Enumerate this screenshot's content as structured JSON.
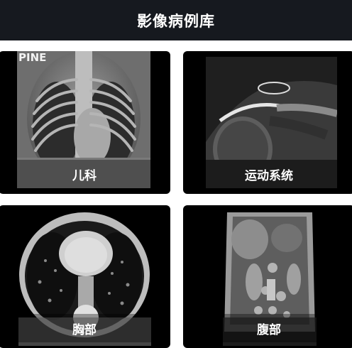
{
  "header": {
    "title": "影像病例库"
  },
  "cards": [
    {
      "label": "儿科",
      "image_text": "PINE"
    },
    {
      "label": "运动系统"
    },
    {
      "label": "胸部"
    },
    {
      "label": "腹部"
    }
  ],
  "colors": {
    "header_bg": "#16191f",
    "card_bg": "#000000",
    "caption_text": "#ffffff"
  }
}
